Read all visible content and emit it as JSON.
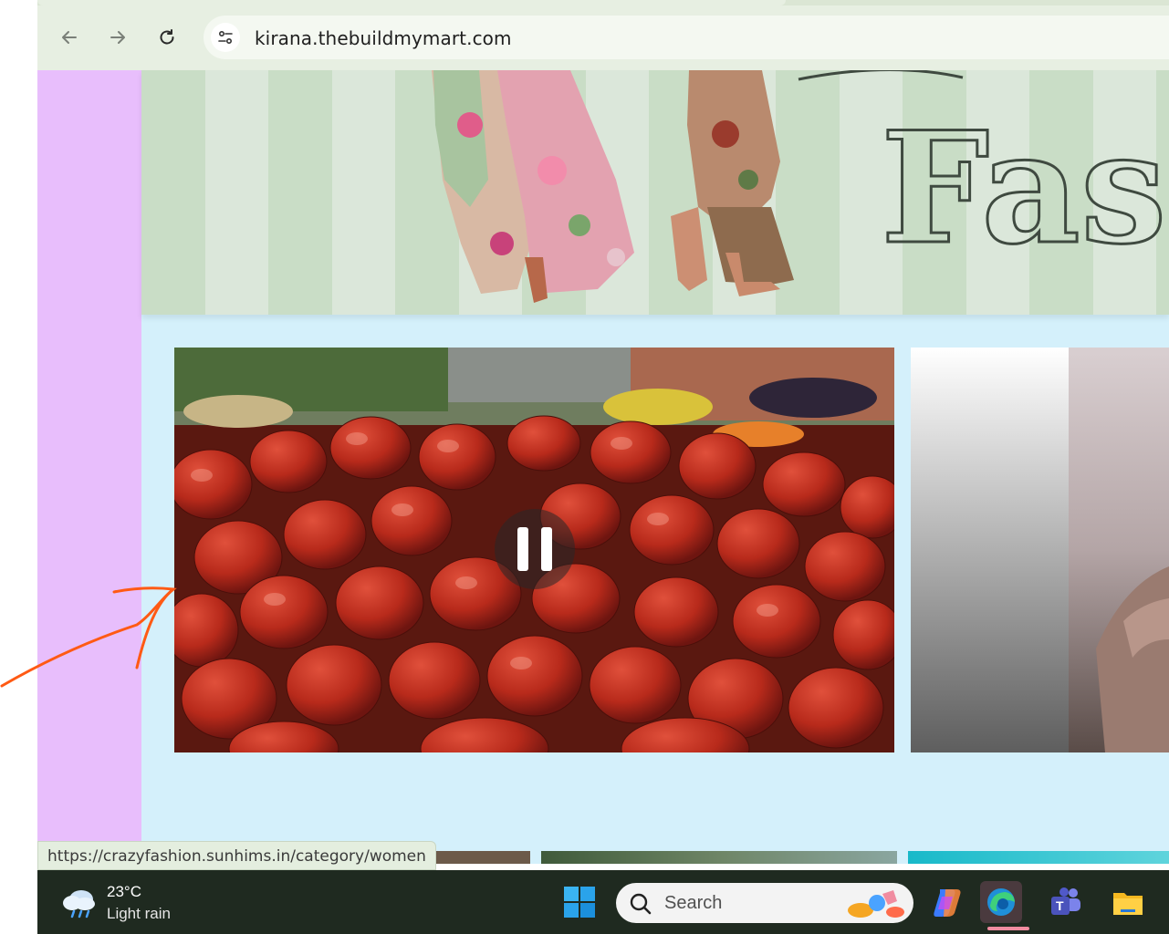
{
  "browser": {
    "back_icon": "arrow-left-icon",
    "forward_icon": "arrow-right-icon",
    "reload_icon": "reload-icon",
    "site_info_icon": "tune-icon",
    "url": "kirana.thebuildmymart.com"
  },
  "banner": {
    "heading_fragment": "Fash",
    "colors": {
      "stripe_dark": "#c9ddc6",
      "stripe_light": "#dbe7da"
    }
  },
  "video": {
    "state": "playing",
    "control_icon": "pause-icon",
    "subject": "tomatoes"
  },
  "status_bar": {
    "link_url": "https://crazyfashion.sunhims.in/category/women"
  },
  "taskbar": {
    "weather": {
      "temp": "23°C",
      "condition": "Light rain",
      "icon": "cloud-rain-icon"
    },
    "search_placeholder": "Search",
    "apps": [
      "windows-start-icon",
      "copilot-icon",
      "edge-icon",
      "teams-icon",
      "file-explorer-icon"
    ],
    "active_app": "edge-icon"
  },
  "colors": {
    "left_rail": "#e8befc",
    "page_bg": "#d4f0fb",
    "annotation_arrow": "#ff5a14",
    "taskbar_bg": "#1f2a20"
  }
}
